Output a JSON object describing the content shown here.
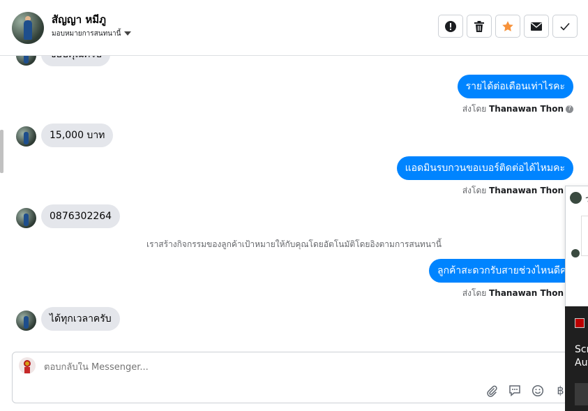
{
  "header": {
    "contact_name": "สัญญา หมีภู",
    "assign_label": "มอบหมายการสนทนานี้",
    "actions": [
      "mark-spam",
      "delete",
      "star",
      "mark-unread",
      "done"
    ]
  },
  "messages": {
    "cut_top": "ขอบคุณครับ",
    "out1": "รายได้ต่อเดือนเท่าไรคะ",
    "sent_by_prefix": "ส่งโดย",
    "agent_name": "Thanawan Thon",
    "in1": "15,000 บาท",
    "out2": "แอดมินรบกวนขอเบอร์ติดต่อได้ไหมคะ",
    "in2": "0876302264",
    "system_note": "เราสร้างกิจกรรมของลูกค้าเป้าหมายให้กับคุณโดยอัตโนมัติโดยอิงตามการสนทนานี้",
    "out3": "ลูกค้าสะดวกรับสายช่วงไหนดีคะ",
    "in3": "ได้ทุกเวลาครับ"
  },
  "composer": {
    "placeholder": "ตอบกลับใน Messenger...",
    "tools": [
      "paperclip-icon",
      "chat-icon",
      "smiley-icon",
      "baht-icon"
    ],
    "baht_symbol": "฿"
  },
  "overlay": {
    "card_char": "ว"
  },
  "toast": {
    "line1": "Scr",
    "line2": "Aut"
  },
  "colors": {
    "outgoing_bubble": "#0084ff",
    "incoming_bubble": "#e4e6eb",
    "star": "#f7923a"
  }
}
